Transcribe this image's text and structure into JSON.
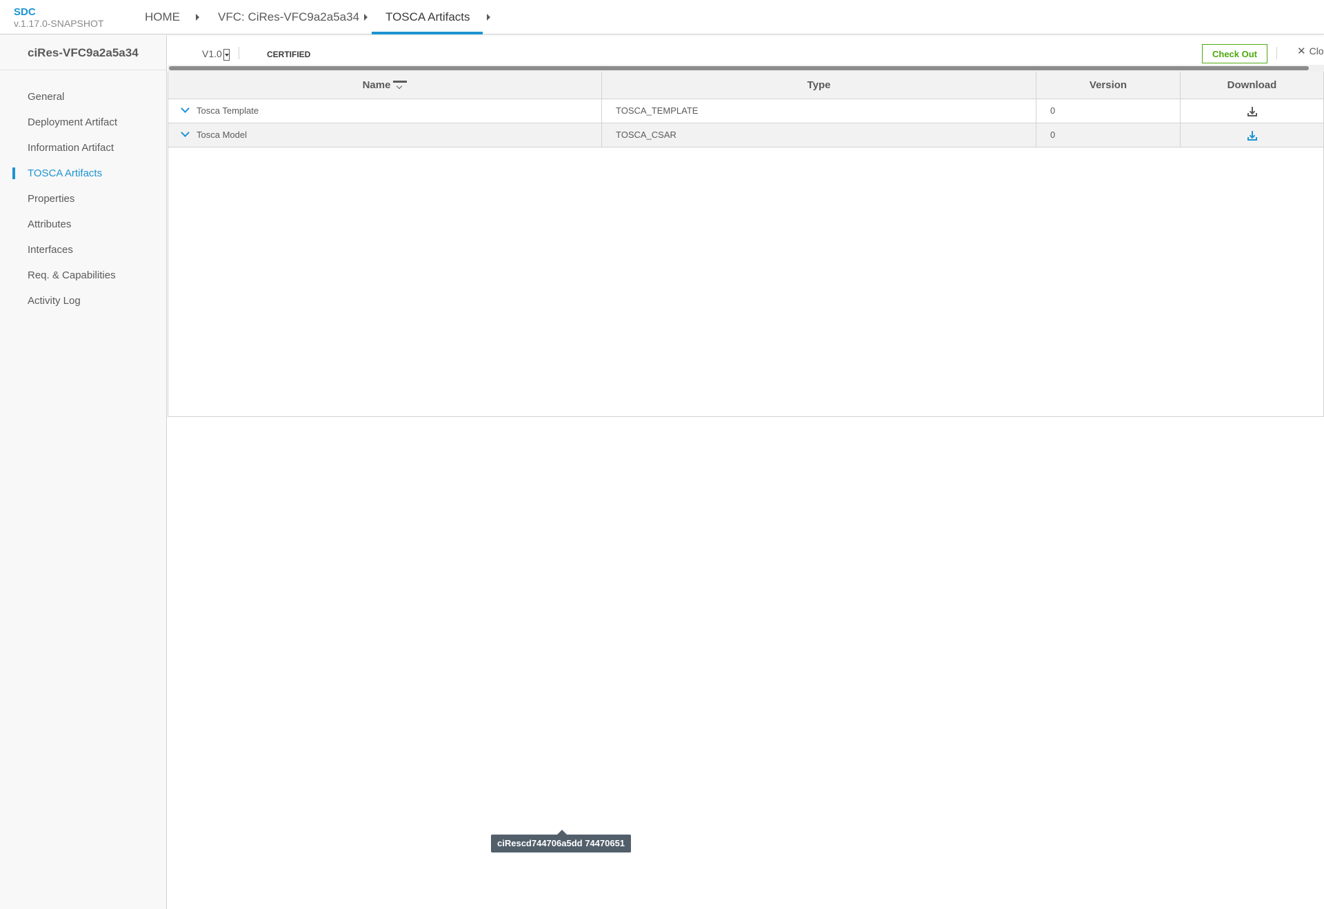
{
  "brand": {
    "name": "SDC",
    "version": "v.1.17.0-SNAPSHOT"
  },
  "breadcrumb": {
    "items": [
      {
        "label": "HOME"
      },
      {
        "label": "VFC: CiRes-VFC9a2a5a34"
      },
      {
        "label": "TOSCA Artifacts",
        "active": true
      }
    ]
  },
  "sidebar": {
    "title": "ciRes-VFC9a2a5a34",
    "items": [
      {
        "label": "General"
      },
      {
        "label": "Deployment Artifact"
      },
      {
        "label": "Information Artifact"
      },
      {
        "label": "TOSCA Artifacts",
        "active": true
      },
      {
        "label": "Properties"
      },
      {
        "label": "Attributes"
      },
      {
        "label": "Interfaces"
      },
      {
        "label": "Req. & Capabilities"
      },
      {
        "label": "Activity Log"
      }
    ]
  },
  "toolbar": {
    "version": "V1.0",
    "status": "CERTIFIED",
    "checkout_label": "Check Out",
    "close_label": "Close"
  },
  "table": {
    "columns": [
      "Name",
      "Type",
      "Version",
      "Download"
    ],
    "sorted_column": "Name",
    "rows": [
      {
        "name": "Tosca Template",
        "type": "TOSCA_TEMPLATE",
        "version": "0",
        "download_icon": "download-icon"
      },
      {
        "name": "Tosca Model",
        "type": "TOSCA_CSAR",
        "version": "0",
        "download_icon": "download-icon"
      }
    ]
  },
  "tooltip": {
    "text": "ciRescd744706a5dd 74470651"
  },
  "colors": {
    "accent": "#1d94d1",
    "checkout": "#4ca90c",
    "tooltip_bg": "#525f6b",
    "text": "#5a5a5a"
  }
}
